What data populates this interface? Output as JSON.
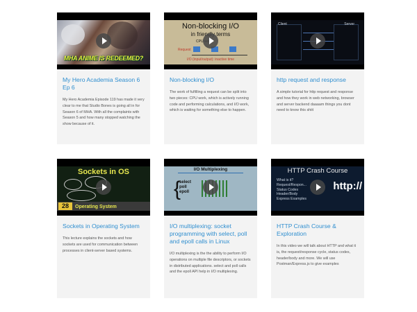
{
  "cards": [
    {
      "title": "My Hero Academia Season 6 Ep 6",
      "description": "My Hero Academia Episode 119 has made it very clear to me that Studio Bones is going all in for Season 6 of MHA. With all the complaints with Season 5 and how many stopped watching the show because of it.",
      "thumbnail": {
        "overlay_text": "MHA ANIME IS REDEEMED?"
      }
    },
    {
      "title": "Non-blocking I/O",
      "description": "The work of fulfilling a request can be split into two pieces: CPU work, which is actively running code and performing calculations, and I/O work, which is waiting for something else to happen.",
      "thumbnail": {
        "heading": "Non-blocking I/O",
        "subheading": "in friendly terms",
        "cpu_label": "CPU work",
        "request_label": "Request",
        "io_label": "I/O (input/output): inactive time"
      }
    },
    {
      "title": "http request and response",
      "description": "A simple tutorial for http request and response and how they work in web networking, browser and server backend daaaam things you dont need to know this shiit",
      "thumbnail": {
        "left_label": "Client",
        "right_label": "Server"
      }
    },
    {
      "title": "Sockets in Operating System",
      "description": "This lecture explains the sockets and how sockets are used for communication between processes in client-server based systems.",
      "thumbnail": {
        "heading": "Sockets in OS",
        "number": "28",
        "footer": "Operating System"
      }
    },
    {
      "title": "I/O multiplexing: socket programming with select, poll and epoll calls in Linux",
      "description": "I/O multiplexing is the the ability to perform I/O operations on multiple file descriptors, or sockets in distributed applications. select and poll calls and the epoll API help in I/O multiplexing.",
      "thumbnail": {
        "heading": "I/O Multiplexing",
        "items": [
          "select",
          "poll",
          "epoll"
        ]
      }
    },
    {
      "title": "HTTP Crash Course & Exploration",
      "description": "In this video we will talk about HTTP and what it is, the request/response cycle, status codes, header/body and more. We will use Postman/Express.js to give examples",
      "thumbnail": {
        "heading": "HTTP Crash Course",
        "bullets": [
          "What is it?",
          "Request/Respon...",
          "Status Codes",
          "Header/Body",
          "Express Examples"
        ],
        "big_text": "http://"
      }
    }
  ]
}
